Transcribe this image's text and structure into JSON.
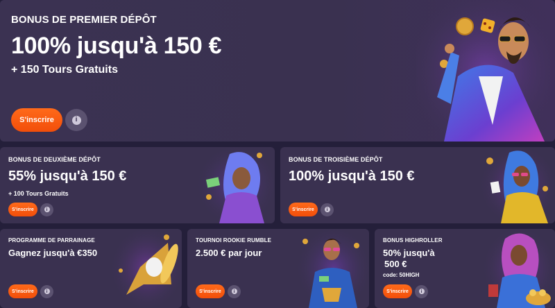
{
  "colors": {
    "page_bg": "#241f3a",
    "card_bg": "#3a3150",
    "cta_orange": "#f25a12",
    "info_bg": "#5b5270"
  },
  "hero": {
    "kicker": "BONUS DE PREMIER DÉPÔT",
    "headline": "100% jusqu'à 150 €",
    "sub": "+ 150 Tours Gratuits",
    "cta": "S'inscrire",
    "info_icon": "i"
  },
  "second": {
    "kicker": "BONUS DE DEUXIÈME DÉPÔT",
    "headline": "55% jusqu'à 150 €",
    "sub": "+ 100 Tours Gratuits",
    "cta": "S'inscrire",
    "info_icon": "i"
  },
  "third": {
    "kicker": "BONUS DE TROISIÈME DÉPÔT",
    "headline": "100% jusqu'à 150 €",
    "cta": "S'inscrire",
    "info_icon": "i"
  },
  "referral": {
    "kicker": "PROGRAMME DE PARRAINAGE",
    "headline": "Gagnez jusqu'à €350",
    "cta": "S'inscrire",
    "info_icon": "i"
  },
  "rookie": {
    "kicker": "TOURNOI ROOKIE RUMBLE",
    "headline": "2.500 € par jour",
    "cta": "S'inscrire",
    "info_icon": "i"
  },
  "highroller": {
    "kicker": "BONUS HIGHROLLER",
    "headline_line1": "50% jusqu'à",
    "headline_line2": "500 €",
    "code": "code: 50HIGH",
    "cta": "S'inscrire",
    "info_icon": "i"
  }
}
